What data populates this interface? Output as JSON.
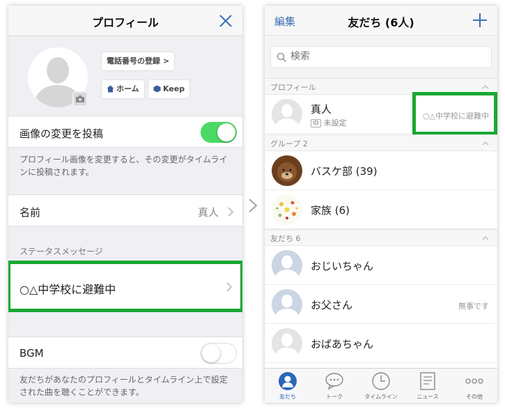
{
  "left": {
    "header_title": "プロフィール",
    "phone_register": "電話番号の登録 >",
    "home_btn": "ホーム",
    "keep_btn": "Keep",
    "post_change_label": "画像の変更を投稿",
    "post_change_on": true,
    "post_change_hint": "プロフィール画像を変更すると、その変更がタイムラインに投稿されます。",
    "name_label": "名前",
    "name_value": "真人",
    "status_section": "ステータスメッセージ",
    "status_message": "○△中学校に避難中",
    "bgm_label": "BGM",
    "bgm_on": false,
    "bgm_hint": "友だちがあなたのプロフィールとタイムライン上で設定された曲を聴くことができます。"
  },
  "right": {
    "edit": "編集",
    "title": "友だち (6人)",
    "search_placeholder": "検索",
    "profile_section": "プロフィール",
    "me": {
      "name": "真人",
      "id_badge": "ID",
      "id_status": "未設定",
      "status": "○△中学校に避難中"
    },
    "group_section": "グループ 2",
    "groups": [
      {
        "name": "バスケ部  (39)"
      },
      {
        "name": "家族  (6)"
      }
    ],
    "friends_section": "友だち 6",
    "friends": [
      {
        "name": "おじいちゃん",
        "status": ""
      },
      {
        "name": "お父さん",
        "status": "無事です"
      },
      {
        "name": "おばあちゃん",
        "status": ""
      }
    ],
    "tabs": [
      {
        "label": "友だち",
        "icon": "person-icon",
        "active": true
      },
      {
        "label": "トーク",
        "icon": "chat-icon",
        "active": false
      },
      {
        "label": "タイムライン",
        "icon": "clock-icon",
        "active": false
      },
      {
        "label": "ニュース",
        "icon": "news-icon",
        "active": false
      },
      {
        "label": "その他",
        "icon": "more-icon",
        "active": false
      }
    ]
  },
  "colors": {
    "highlight": "#19a832",
    "toggle_on": "#4cd964",
    "accent": "#3b6fb6"
  }
}
